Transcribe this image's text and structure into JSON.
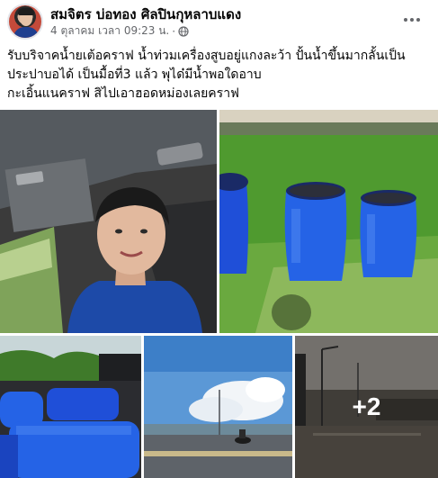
{
  "post": {
    "author": "สมจิตร บ่อทอง ศิลปินกุหลาบแดง",
    "timestamp": "4 ตุลาคม เวลา 09:23 น.",
    "separator": "·",
    "privacy_icon": "globe-icon",
    "more_icon": "ellipsis-icon",
    "text_lines": [
      "รับบริจาคน้ำยเต้อคราฟ น้ำท่วมเครื่องสูบอยู่แกงละว้า ปั้นน้ำขึ้นมากลั้นเป็น",
      "ประปาบอได้ เป็นมื้อที่3 แล้ว พุได๋มีน้ำพอใดอาบ",
      "กะเอิ้นแนคราฟ สิไปเอาฮอดหม่องเลยคราฟ"
    ]
  },
  "photos": {
    "items": [
      {
        "id": "selfie-in-car",
        "icon": "photo"
      },
      {
        "id": "blue-barrels-on-grass",
        "icon": "photo"
      },
      {
        "id": "blue-barrels-in-truck",
        "icon": "photo"
      },
      {
        "id": "flooded-road-motorcycle",
        "icon": "photo"
      },
      {
        "id": "flooded-street-evening",
        "icon": "photo"
      }
    ],
    "more_count_label": "+2"
  },
  "colors": {
    "text_primary": "#050505",
    "text_secondary": "#65676b",
    "barrel_blue": "#1f4fd8",
    "grass_green": "#4f9a2f"
  }
}
